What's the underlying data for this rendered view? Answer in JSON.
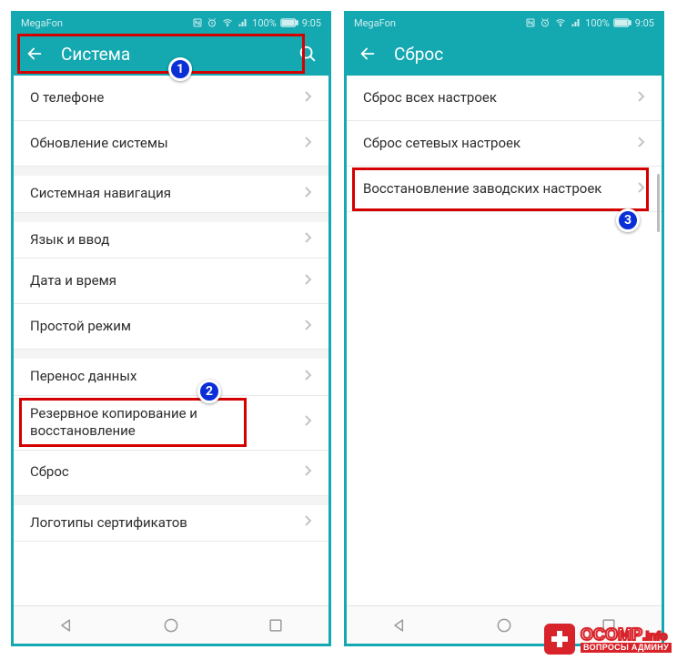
{
  "status": {
    "carrier": "MegaFon",
    "battery": "100%",
    "time": "9:05"
  },
  "left": {
    "title": "Система",
    "items": [
      "О телефоне",
      "Обновление системы",
      "Системная навигация",
      "Язык и ввод",
      "Дата и время",
      "Простой режим",
      "Перенос данных",
      "Резервное копирование и восстановление",
      "Сброс",
      "Логотипы сертификатов"
    ]
  },
  "right": {
    "title": "Сброс",
    "items": [
      "Сброс всех настроек",
      "Сброс сетевых настроек",
      "Восстановление заводских настроек"
    ]
  },
  "badges": {
    "b1": "1",
    "b2": "2",
    "b3": "3"
  },
  "watermark": {
    "brand": "OCOMP",
    "suffix": ".info",
    "tag": "ВОПРОСЫ АДМИНУ"
  }
}
